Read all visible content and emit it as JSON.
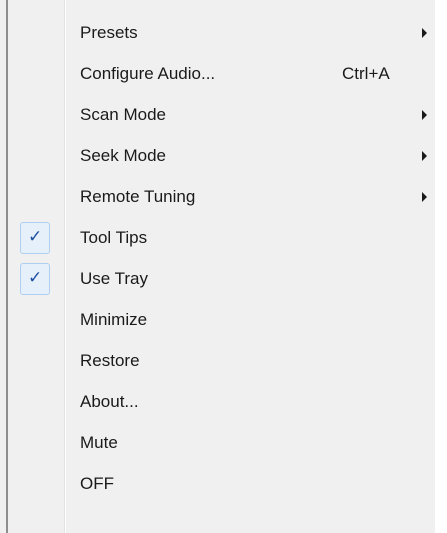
{
  "menu": {
    "items": [
      {
        "label": "Presets",
        "shortcut": "",
        "submenu": true,
        "checked": false
      },
      {
        "label": "Configure Audio...",
        "shortcut": "Ctrl+A",
        "submenu": false,
        "checked": false
      },
      {
        "label": "Scan Mode",
        "shortcut": "",
        "submenu": true,
        "checked": false
      },
      {
        "label": "Seek Mode",
        "shortcut": "",
        "submenu": true,
        "checked": false
      },
      {
        "label": "Remote Tuning",
        "shortcut": "",
        "submenu": true,
        "checked": false
      },
      {
        "label": "Tool Tips",
        "shortcut": "",
        "submenu": false,
        "checked": true
      },
      {
        "label": "Use Tray",
        "shortcut": "",
        "submenu": false,
        "checked": true
      },
      {
        "label": "Minimize",
        "shortcut": "",
        "submenu": false,
        "checked": false
      },
      {
        "label": "Restore",
        "shortcut": "",
        "submenu": false,
        "checked": false
      },
      {
        "label": "About...",
        "shortcut": "",
        "submenu": false,
        "checked": false
      },
      {
        "label": "Mute",
        "shortcut": "",
        "submenu": false,
        "checked": false
      },
      {
        "label": "OFF",
        "shortcut": "",
        "submenu": false,
        "checked": false
      }
    ],
    "check_glyph": "✓",
    "colors": {
      "background": "#f0f0f0",
      "text": "#1a1a1a",
      "check": "#1f4fa0",
      "check_box_fill": "#e6f0fa",
      "check_box_border": "#aecff0"
    }
  }
}
